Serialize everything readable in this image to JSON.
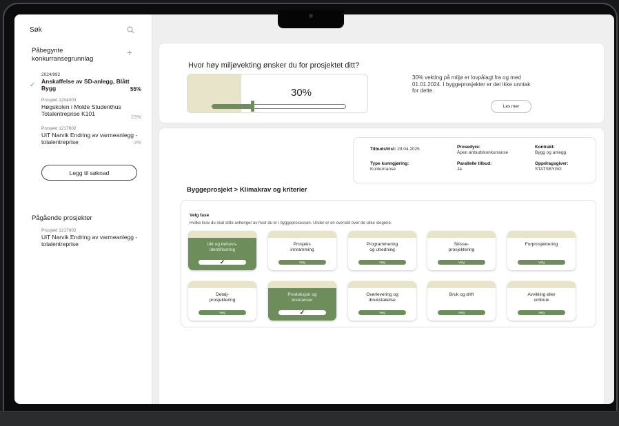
{
  "sidebar": {
    "search_label": "Søk",
    "started_title": "Påbegynte konkurransegrunnlag",
    "projects": [
      {
        "sub": "2024/992",
        "name": "Anskaffelse av SD-anlegg, Blått Bygg",
        "pct": "55%",
        "active": true
      },
      {
        "sub": "Prosjekt 1204003",
        "name": "Høgskolen i Molde Studenthus Totalentreprise K101",
        "pct": "23%",
        "active": false
      },
      {
        "sub": "Prosjekt 1217602",
        "name": "UiT Narvik Endring av varmeanlegg - totalentreprise",
        "pct": "3%",
        "active": false
      }
    ],
    "add_label": "Legg til søknad",
    "ongoing_title": "Pågående prosjekter",
    "ongoing": [
      {
        "sub": "Prosjekt 1217602",
        "name": "UiT Narvik Endring av varmeanlegg - totalentreprise"
      }
    ]
  },
  "weighting": {
    "question": "Hvor høy miljøvekting ønsker du for prosjektet ditt?",
    "value_label": "30%",
    "value": 0.3,
    "info": "30% vekting på miljø er lovpålagt fra og med 01.01.2024. I byggeprosjekter er det ikke unntak for dette.",
    "read_more": "Les mer"
  },
  "meta": {
    "tilbudsfrist_label": "Tilbudsfrist:",
    "tilbudsfrist": "29.04.2025",
    "type_label": "Type kunngjøring:",
    "type": "Konkurranse",
    "prosedyre_label": "Prosedyre:",
    "prosedyre": "Åpen anbudskonkurranse",
    "parallelle_label": "Parallelle tilbud:",
    "parallelle": "Ja",
    "kontrakt_label": "Kontrakt:",
    "kontrakt": "Bygg og anlegg",
    "oppdragsgiver_label": "Oppdragsgiver:",
    "oppdragsgiver": "STATSBYGG"
  },
  "breadcrumb": "Byggeprosjekt > Klimakrav og kriterier",
  "phase": {
    "title": "Velg fase",
    "description": "Hvilke krav du skal stille avhenger av hvor du er i byggeprosessen. Under er en oversikt over de ulike stegene.",
    "select_label": "Velg",
    "selected_mark": "✓",
    "tiles": [
      {
        "label": "Idé og behovs-\nidentifisering",
        "selected": true
      },
      {
        "label": "Prosjekt-\ninnramming",
        "selected": false
      },
      {
        "label": "Programmering\nog utredning",
        "selected": false
      },
      {
        "label": "Skisse-\nprosjektering",
        "selected": false
      },
      {
        "label": "Forprosjektering",
        "selected": false
      },
      {
        "label": "Detalj-\nprosjektering",
        "selected": false
      },
      {
        "label": "Produksjon og\nleveranser",
        "selected": true
      },
      {
        "label": "Overlevering og\nibrukstakelse",
        "selected": false
      },
      {
        "label": "Bruk og drift",
        "selected": false
      },
      {
        "label": "Avvikling eller\nombruk",
        "selected": false
      }
    ]
  }
}
